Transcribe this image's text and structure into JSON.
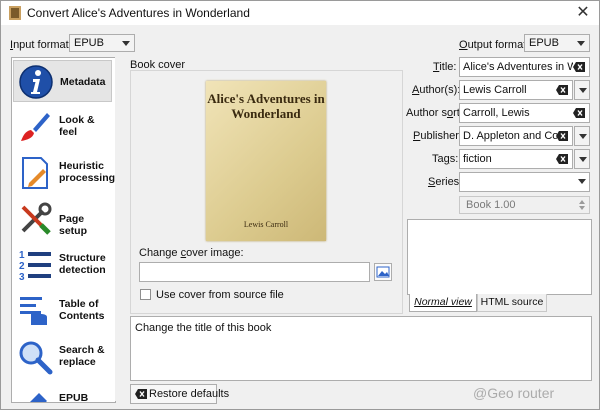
{
  "window": {
    "title": "Convert Alice's Adventures in Wonderland"
  },
  "formats": {
    "input_label": "Input format:",
    "input_value": "EPUB",
    "output_label": "Output format:",
    "output_value": "EPUB"
  },
  "sidebar": {
    "items": [
      {
        "label": "Metadata",
        "icon": "info-icon"
      },
      {
        "label": "Look &\nfeel",
        "icon": "paintbrush-icon"
      },
      {
        "label": "Heuristic\nprocessing",
        "icon": "document-edit-icon"
      },
      {
        "label": "Page setup",
        "icon": "tools-icon"
      },
      {
        "label": "Structure\ndetection",
        "icon": "numbered-list-icon"
      },
      {
        "label": "Table of\nContents",
        "icon": "toc-pointer-icon"
      },
      {
        "label": "Search &\nreplace",
        "icon": "magnifier-icon"
      },
      {
        "label": "EPUB",
        "icon": "epub-icon"
      }
    ]
  },
  "cover": {
    "group_label": "Book cover",
    "book_title": "Alice's Adventures in Wonderland",
    "book_author": "Lewis Carroll",
    "change_label": "Change cover image:",
    "change_value": "",
    "use_source_label": "Use cover from source file"
  },
  "metadata": {
    "title_label": "Title:",
    "title_value": "Alice's Adventures in Wonderland",
    "authors_label": "Author(s):",
    "authors_value": "Lewis Carroll",
    "author_sort_label": "Author sort:",
    "author_sort_value": "Carroll, Lewis",
    "publisher_label": "Publisher:",
    "publisher_value": "D. Appleton and Co",
    "tags_label": "Tags:",
    "tags_value": "fiction",
    "series_label": "Series:",
    "series_value": "",
    "series_number": "Book 1.00"
  },
  "comments_tabs": {
    "normal": "Normal view",
    "html": "HTML source"
  },
  "help_text": "Change the title of this book",
  "buttons": {
    "restore": "Restore defaults"
  },
  "watermark": "@Geo  router"
}
